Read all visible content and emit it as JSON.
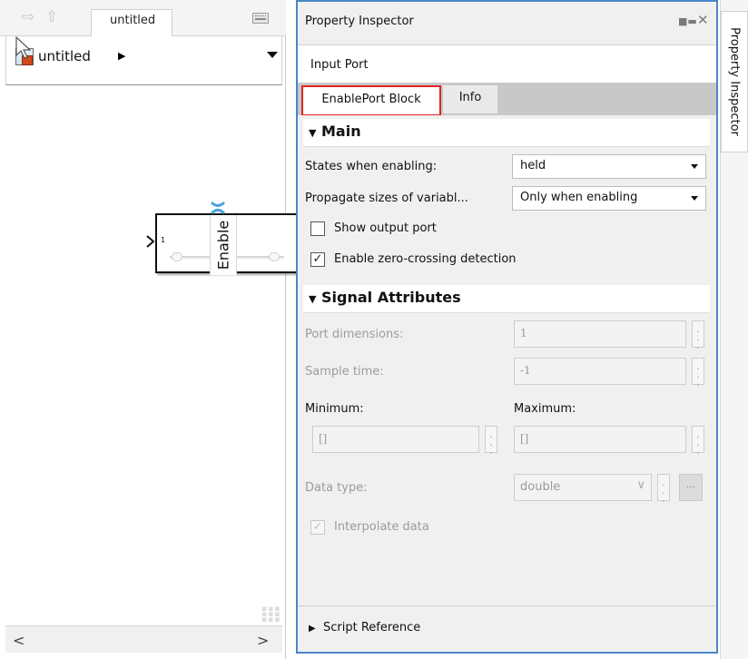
{
  "editor": {
    "tab_title": "untitled",
    "breadcrumb": "untitled",
    "block": {
      "label": "Enable",
      "port_number": "1"
    }
  },
  "inspector": {
    "title": "Property Inspector",
    "block_type": "Input Port",
    "tabs": [
      {
        "label": "EnablePort Block",
        "active": true
      },
      {
        "label": "Info",
        "active": false
      }
    ],
    "main": {
      "header": "Main",
      "states_label": "States when enabling:",
      "states_value": "held",
      "propagate_label": "Propagate sizes of variabl...",
      "propagate_value": "Only when enabling",
      "show_output_label": "Show output port",
      "show_output_checked": false,
      "zero_crossing_label": "Enable zero-crossing detection",
      "zero_crossing_checked": true
    },
    "signal": {
      "header": "Signal Attributes",
      "port_dimensions_label": "Port dimensions:",
      "port_dimensions_value": "1",
      "sample_time_label": "Sample time:",
      "sample_time_value": "-1",
      "minimum_label": "Minimum:",
      "minimum_value": "[]",
      "maximum_label": "Maximum:",
      "maximum_value": "[]",
      "data_type_label": "Data type:",
      "data_type_value": "double",
      "assistant_label": "...",
      "interpolate_label": "Interpolate data",
      "interpolate_checked": true
    },
    "script_reference": "Script Reference"
  },
  "side_tab": {
    "label": "Property Inspector"
  },
  "colors": {
    "inspector_border": "#4a86c7",
    "tab_highlight": "#e02424",
    "port_marker": "#4aa3df"
  }
}
